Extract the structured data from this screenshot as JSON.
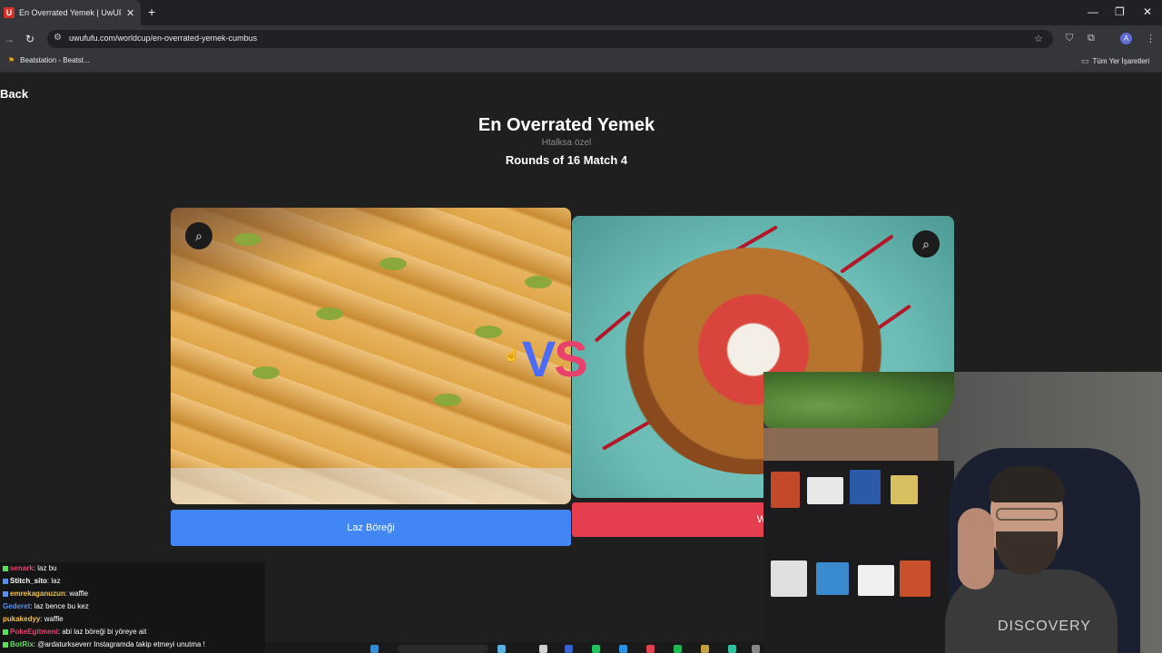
{
  "browser": {
    "tab_title": "En Overrated Yemek | UwUFUFU",
    "tab_favicon": "U",
    "new_tab": "+",
    "url": "uwufufu.com/worldcup/en-overrated-yemek-cumbus",
    "profile_initial": "A",
    "bookmarks": {
      "item1": "Beatstation - Beatst...",
      "all_bookmarks": "Tüm Yer İşaretleri"
    }
  },
  "page": {
    "back_label": "Back",
    "title": "En Overrated Yemek",
    "subtitle": "Htalksa özel",
    "round_label": "Rounds of 16 Match 4",
    "vs_v": "V",
    "vs_s": "S",
    "left_choice": "Laz Böreği",
    "right_choice": "Wa"
  },
  "webcam": {
    "shirt_text": "DISCOVERY"
  },
  "chat": {
    "messages": [
      {
        "user": "senark",
        "text": ": laz bu",
        "color": "#e8416e"
      },
      {
        "user": "Stitch_sito",
        "text": ": laz",
        "color": "#ffffff"
      },
      {
        "user": "emrekaganuzun",
        "text": ": waffle",
        "color": "#f0c24b"
      },
      {
        "user": "Gederet",
        "text": ": laz bence bu kez",
        "color": "#5b8def"
      },
      {
        "user": "pukakedyy",
        "text": ": waffle",
        "color": "#f0c24b"
      },
      {
        "user": "PokeEgitmeni",
        "text": ": abi laz böreği bi yöreye ait",
        "color": "#e8416e"
      },
      {
        "user": "BotRix",
        "text": ": @ardaturkseverr Instagramda takip etmeyi unutma !",
        "color": "#5ce05c"
      }
    ]
  },
  "colors": {
    "left_button": "#4285f4",
    "right_button": "#e53e4e",
    "vs_v": "#4a6cf7",
    "vs_s": "#e8416e"
  }
}
